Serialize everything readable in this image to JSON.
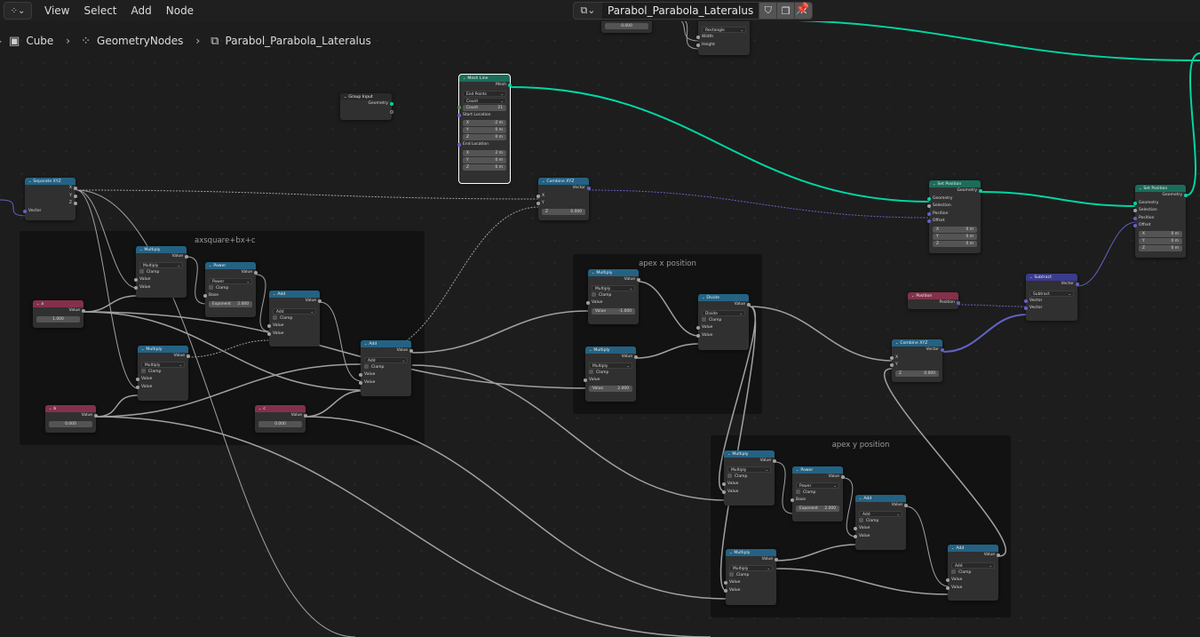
{
  "header": {
    "editor_type_icon": "geometry-nodes-icon",
    "menus": [
      "View",
      "Select",
      "Add",
      "Node"
    ],
    "node_tree_name": "Parabol_Parabola_Lateralus",
    "buttons": [
      "fake-user-shield-icon",
      "duplicate-icon",
      "unlink-close-icon"
    ],
    "pin_icon": "pin-icon"
  },
  "breadcrumb": [
    {
      "icon": "mesh-object-icon",
      "glyph": "▣",
      "label": "Cube"
    },
    {
      "icon": "geometry-nodes-modifier-icon",
      "glyph": "⁘",
      "label": "GeometryNodes"
    },
    {
      "icon": "node-tree-icon",
      "glyph": "⧉",
      "label": "Parabol_Parabola_Lateralus"
    }
  ],
  "frames": [
    {
      "label": "axsquare+bx+c"
    },
    {
      "label": "apex x position"
    },
    {
      "label": "apex y position"
    }
  ],
  "nodes": {
    "partial_top_left": {
      "value": "0.000"
    },
    "partial_top_rect": {
      "mode": "Rectangle",
      "inputs": [
        "Width",
        "Height"
      ]
    },
    "group_input": {
      "title": "Group Input",
      "outputs": [
        "Geometry"
      ]
    },
    "mesh_line": {
      "title": "Mesh Line",
      "output": "Mesh",
      "mode": "End Points",
      "count_mode": "Count",
      "count_label": "Count",
      "count_value": "21",
      "start_label": "Start Location",
      "start": [
        [
          "X",
          "-2 m"
        ],
        [
          "Y",
          "0 m"
        ],
        [
          "Z",
          "0 m"
        ]
      ],
      "end_label": "End Location",
      "end": [
        [
          "X",
          "2 m"
        ],
        [
          "Y",
          "0 m"
        ],
        [
          "Z",
          "0 m"
        ]
      ]
    },
    "separate_xyz": {
      "title": "Separate XYZ",
      "outputs": [
        "X",
        "Y",
        "Z"
      ],
      "input": "Vector"
    },
    "combine_xyz_1": {
      "title": "Combine XYZ",
      "output": "Vector",
      "inputs": [
        "X",
        "Y"
      ],
      "z_label": "Z",
      "z_value": "0.000"
    },
    "set_position_1": {
      "title": "Set Position",
      "output": "Geometry",
      "inputs": [
        "Geometry",
        "Selection",
        "Position",
        "Offset"
      ],
      "offset": [
        [
          "X",
          "0 m"
        ],
        [
          "Y",
          "0 m"
        ],
        [
          "Z",
          "0 m"
        ]
      ]
    },
    "set_position_2": {
      "title": "Set Position",
      "output": "Geometry",
      "inputs": [
        "Geometry",
        "Selection",
        "Position",
        "Offset"
      ],
      "offset": [
        [
          "X",
          "0 m"
        ],
        [
          "Y",
          "0 m"
        ],
        [
          "Z",
          "0 m"
        ]
      ]
    },
    "a": {
      "title": "a",
      "output": "Value",
      "value": "1.000"
    },
    "b": {
      "title": "b",
      "output": "Value",
      "value": "0.000"
    },
    "c": {
      "title": "c",
      "output": "Value",
      "value": "0.000"
    },
    "multiply_1": {
      "title": "Multiply",
      "output": "Value",
      "op": "Multiply",
      "clamp": "Clamp",
      "inputs": [
        "Value",
        "Value"
      ]
    },
    "power_1": {
      "title": "Power",
      "output": "Value",
      "op": "Power",
      "clamp": "Clamp",
      "base": "Base",
      "exp_label": "Exponent",
      "exp_value": "2.000"
    },
    "add_1": {
      "title": "Add",
      "output": "Value",
      "op": "Add",
      "clamp": "Clamp",
      "inputs": [
        "Value",
        "Value"
      ]
    },
    "multiply_2": {
      "title": "Multiply",
      "output": "Value",
      "op": "Multiply",
      "clamp": "Clamp",
      "inputs": [
        "Value",
        "Value"
      ]
    },
    "add_2": {
      "title": "Add",
      "output": "Value",
      "op": "Add",
      "clamp": "Clamp",
      "inputs": [
        "Value",
        "Value"
      ]
    },
    "multiply_3": {
      "title": "Multiply",
      "output": "Value",
      "op": "Multiply",
      "clamp": "Clamp",
      "input": "Value",
      "field_label": "Value",
      "field_value": "-1.000"
    },
    "multiply_4": {
      "title": "Multiply",
      "output": "Value",
      "op": "Multiply",
      "clamp": "Clamp",
      "input": "Value",
      "field_label": "Value",
      "field_value": "2.000"
    },
    "divide": {
      "title": "Divide",
      "output": "Value",
      "op": "Divide",
      "clamp": "Clamp",
      "inputs": [
        "Value",
        "Value"
      ]
    },
    "combine_xyz_2": {
      "title": "Combine XYZ",
      "output": "Vector",
      "inputs": [
        "X",
        "Y"
      ],
      "z_label": "Z",
      "z_value": "0.000"
    },
    "position": {
      "title": "Position",
      "output": "Position"
    },
    "subtract": {
      "title": "Subtract",
      "output": "Vector",
      "op": "Subtract",
      "inputs": [
        "Vector",
        "Vector"
      ]
    },
    "multiply_5": {
      "title": "Multiply",
      "output": "Value",
      "op": "Multiply",
      "clamp": "Clamp",
      "inputs": [
        "Value",
        "Value"
      ]
    },
    "power_2": {
      "title": "Power",
      "output": "Value",
      "op": "Power",
      "clamp": "Clamp",
      "base": "Base",
      "exp_label": "Exponent",
      "exp_value": "2.000"
    },
    "add_3": {
      "title": "Add",
      "output": "Value",
      "op": "Add",
      "clamp": "Clamp",
      "inputs": [
        "Value",
        "Value"
      ]
    },
    "multiply_6": {
      "title": "Multiply",
      "output": "Value",
      "op": "Multiply",
      "clamp": "Clamp",
      "inputs": [
        "Value",
        "Value"
      ]
    },
    "add_4": {
      "title": "Add",
      "output": "Value",
      "op": "Add",
      "clamp": "Clamp",
      "inputs": [
        "Value",
        "Value"
      ]
    }
  },
  "colors": {
    "math_header": "#246283",
    "geometry_header": "#1b6d5a",
    "input_header": "#83314a",
    "vector_header": "#3b3b8f",
    "geometry_wire": "#00d6a3",
    "vector_wire": "#6363c7",
    "float_wire": "#a1a1a1"
  }
}
